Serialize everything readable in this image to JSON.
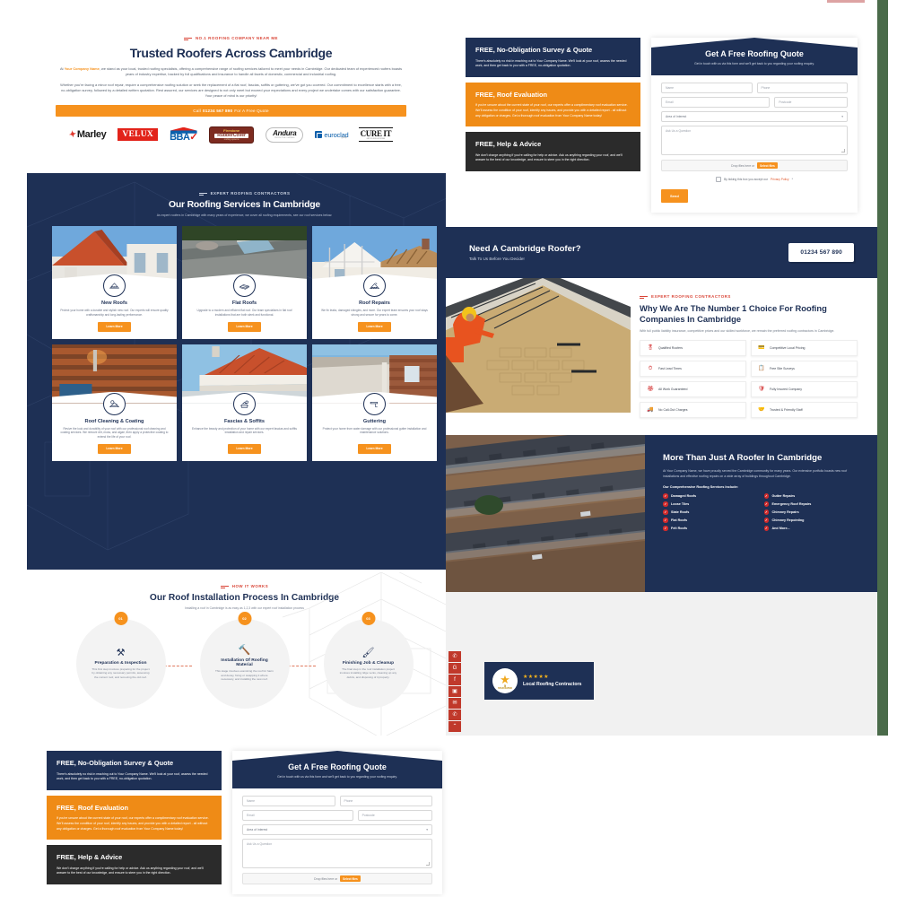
{
  "hero": {
    "eyebrow": "NO.1 ROOFING COMPANY NEAR ME",
    "title": "Trusted Roofers Across Cambridge",
    "paragraph1_pre": "At ",
    "paragraph1_highlight": "Your Company Name",
    "paragraph1_post": ", we stand as your local, trusted roofing specialists, offering a comprehensive range of roofing services tailored to meet your needs in Cambridge. Our dedicated team of experienced roofers boasts years of industry expertise, backed by full qualifications and insurance to handle all facets of domestic, commercial and industrial roofing.",
    "paragraph2": "Whether you're facing a minor roof repair, require a comprehensive roofing solution or seek the replacement of a flat roof, fascias, soffits or guttering, we've got you covered. Our commitment to excellence starts with a free, no-obligation survey, followed by a detailed written quotation. Rest assured, our services are designed to not only meet but exceed your expectations and every project we undertake comes with our satisfaction guarantee. Your peace of mind is our priority!",
    "cta_prefix": "Call",
    "cta_phone": "01234 567 890",
    "cta_suffix": "For A Free Quote",
    "logos": [
      "Marley",
      "VELUX",
      "BBA",
      "Firestone RubberCover",
      "Andura",
      "euroclad",
      "CURE IT"
    ]
  },
  "services": {
    "eyebrow": "EXPERT ROOFING CONTRACTORS",
    "title": "Our Roofing Services In Cambridge",
    "subtitle": "As expert roofers in Cambridge with many years of experience, we cover all roofing requirements, see our roof services below.",
    "button_label": "Learn More",
    "cards": [
      {
        "name": "New Roofs",
        "icon": "new-roof-icon",
        "desc": "Protect your home with a durable and stylish new roof. Our experts will ensure quality craftsmanship and long-lasting performance."
      },
      {
        "name": "Flat Roofs",
        "icon": "flat-roof-icon",
        "desc": "Upgrade to a modern and efficient flat roof. Our team specialises in flat roof installations that are both sleek and functional."
      },
      {
        "name": "Roof Repairs",
        "icon": "roof-repair-icon",
        "desc": "We fix leaks, damaged shingles, and more. Our expert team ensures your roof stays strong and secure for years to come."
      },
      {
        "name": "Roof Cleaning & Coating",
        "icon": "roof-cleaning-icon",
        "desc": "Revive the look and durability of your roof with our professional roof cleaning and coating services. We remove dirt, moss, and algae, then apply a protective coating to extend the life of your roof."
      },
      {
        "name": "Fascias & Soffits",
        "icon": "fascia-soffit-icon",
        "desc": "Enhance the beauty and protection of your home with our expert fascias and soffits installation and repair services."
      },
      {
        "name": "Guttering",
        "icon": "guttering-icon",
        "desc": "Protect your home from water damage with our professional gutter installation and maintenance solutions."
      }
    ]
  },
  "process": {
    "eyebrow": "HOW IT WORKS",
    "title": "Our Roof Installation Process In Cambridge",
    "subtitle": "Installing a roof in Cambridge is as easy as 1,2,3 with our expert roof installation process",
    "steps": [
      {
        "num": "01",
        "icon": "tools-icon",
        "glyph": "⚒",
        "name": "Preparation & Inspection",
        "desc": "This first step involves preparing for the project by obtaining any necessary permits, assessing the current roof, and removing the old roof."
      },
      {
        "num": "02",
        "icon": "hammer-icon",
        "glyph": "🔨",
        "name": "Installation Of Roofing Material",
        "desc": "This stage involves examining the roof for harm and decay, fixing or swapping it where necessary, and installing the new roof."
      },
      {
        "num": "03",
        "icon": "brush-icon",
        "glyph": "🖌",
        "name": "Finishing Job & Cleanup",
        "desc": "The final step in the roof installation project involves installing ridge vents, cleaning up any debris, and disposing of it properly."
      }
    ]
  },
  "quote": {
    "cards": [
      {
        "title": "FREE, No-Obligation Survey & Quote",
        "style": "navy",
        "body": "There's absolutely no risk in reaching out to Your Company Name. We'll look at your roof, assess the needed work, and then get back to you with a FREE, no-obligation quotation."
      },
      {
        "title": "FREE, Roof Evaluation",
        "style": "orange",
        "body": "If you're unsure about the current state of your roof, our experts offer a complimentary roof evaluation service. We'll assess the condition of your roof, identify any issues, and provide you with a detailed report - all without any obligation or charges. Get a thorough roof evaluation from Your Company Name today!"
      },
      {
        "title": "FREE, Help & Advice",
        "style": "dark",
        "body": "We don't charge anything if you're calling for help or advice. Ask us anything regarding your roof, and we'll answer to the best of our knowledge, and ensure to steer you in the right direction."
      }
    ],
    "form": {
      "title": "Get A Free Roofing Quote",
      "subtitle": "Get in touch with us via this form and we'll get back to you regarding your roofing enquiry.",
      "name_placeholder": "Name",
      "phone_placeholder": "Phone",
      "email_placeholder": "Email",
      "postcode_placeholder": "Postcode",
      "interest_value": "Area of Interest",
      "question_placeholder": "Ask Us a Question",
      "drop_label": "Drop files here or",
      "select_files_label": "Select files",
      "privacy_pre": "By ticking this box you accept our",
      "privacy_link": "Privacy Policy",
      "privacy_post": "*",
      "send_label": "Send"
    }
  },
  "cta_band": {
    "title": "Need A Cambridge Roofer?",
    "subtitle": "Talk To Us Before You Decide!",
    "phone": "01234 567 890"
  },
  "why": {
    "eyebrow": "EXPERT ROOFING CONTRACTORS",
    "title": "Why We Are The Number 1 Choice For Roofing Companies In Cambridge",
    "subtitle": "With full public liability insurance, competitive prices and our skilled workforce, we remain the preferred roofing contractors in Cambridge.",
    "items": [
      {
        "label": "Qualified Roofers",
        "icon": "certificate-icon",
        "glyph": "🎖"
      },
      {
        "label": "Competitive Local Pricing",
        "icon": "money-icon",
        "glyph": "💳"
      },
      {
        "label": "Fast Lead Times",
        "icon": "stopwatch-icon",
        "glyph": "⏱"
      },
      {
        "label": "Free Site Surveys",
        "icon": "clipboard-icon",
        "glyph": "📋"
      },
      {
        "label": "All Work Guaranteed",
        "icon": "rosette-icon",
        "glyph": "🏵"
      },
      {
        "label": "Fully Insured Company",
        "icon": "shield-icon",
        "glyph": "🛡"
      },
      {
        "label": "No Call-Out Charges",
        "icon": "van-icon",
        "glyph": "🚚"
      },
      {
        "label": "Trusted & Friendly Staff",
        "icon": "handshake-icon",
        "glyph": "🤝"
      }
    ]
  },
  "more": {
    "title": "More Than Just A Roofer In Cambridge",
    "body": "At Your Company Name, we have proudly served the Cambridge community for many years. Our extensive portfolio boasts new roof installations and effective roofing repairs on a wide array of buildings throughout Cambridge.",
    "list_heading": "Our Comprehensive Roofing Services Include:",
    "items": [
      "Damaged Roofs",
      "Gutter Repairs",
      "Loose Tiles",
      "Emergency Roof Repairs",
      "Slate Roofs",
      "Chimney Repairs",
      "Flat Roofs",
      "Chimney Repointing",
      "Felt Roofs",
      "And More..."
    ]
  },
  "badge": {
    "stars": "★★★★★",
    "seal_star": "★",
    "seal_line1": "5",
    "seal_line2": "STAR RATED",
    "title": "Local Roofing Contractors"
  },
  "social": [
    {
      "name": "whatsapp-icon",
      "glyph": "✆"
    },
    {
      "name": "google-icon",
      "glyph": "G"
    },
    {
      "name": "facebook-icon",
      "glyph": "f"
    },
    {
      "name": "instagram-icon",
      "glyph": "▣"
    },
    {
      "name": "email-icon",
      "glyph": "✉"
    },
    {
      "name": "phone-icon",
      "glyph": "✆"
    },
    {
      "name": "scroll-top-icon",
      "glyph": "⌃"
    }
  ],
  "colors": {
    "navy": "#1e3055",
    "orange": "#f6921e",
    "red": "#d22b2b",
    "dark": "#2b2b2b"
  }
}
